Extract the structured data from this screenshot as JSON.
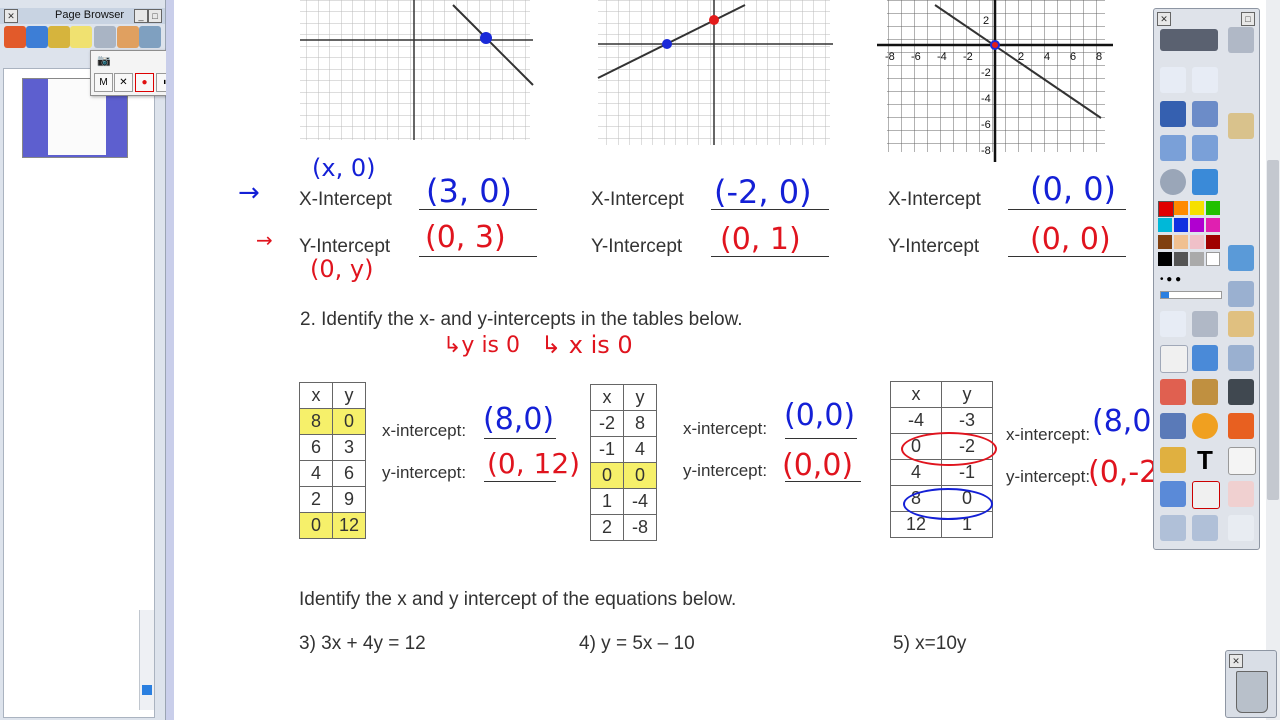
{
  "page_browser": {
    "title": "Page Browser",
    "tools": [
      "page-icon",
      "gallery-icon",
      "attachment-icon",
      "notes-icon",
      "properties-icon",
      "document-icon",
      "addon-icon"
    ]
  },
  "recorder": {
    "buttons": [
      "M",
      "✕",
      "●",
      "⏸",
      "■",
      "▶"
    ]
  },
  "worksheet": {
    "graphs": [
      {
        "xint_label": "X-Intercept",
        "yint_label": "Y-Intercept",
        "x_answer": "(3, 0)",
        "y_answer": "(0, 3)"
      },
      {
        "xint_label": "X-Intercept",
        "yint_label": "Y-Intercept",
        "x_answer": "(-2, 0)",
        "y_answer": "(0, 1)"
      },
      {
        "xint_label": "X-Intercept",
        "yint_label": "Y-Intercept",
        "x_answer": "(0, 0)",
        "y_answer": "(0, 0)"
      }
    ],
    "note_x0": "(x, 0)",
    "note_0y": "(0, y)",
    "graph3_ticks": [
      "-8",
      "-6",
      "-4",
      "-2",
      "2",
      "4",
      "6",
      "8"
    ],
    "graph3_yticks": [
      "2",
      "-2",
      "-4",
      "-6",
      "-8"
    ],
    "q2_text": "2. Identify the x- and y-intercepts in the tables below.",
    "q2_note1": "↳y is 0",
    "q2_note2": "↳ x is 0",
    "tables": [
      {
        "headers": [
          "x",
          "y"
        ],
        "rows": [
          [
            "8",
            "0"
          ],
          [
            "6",
            "3"
          ],
          [
            "4",
            "6"
          ],
          [
            "2",
            "9"
          ],
          [
            "0",
            "12"
          ]
        ],
        "xint_label": "x-intercept:",
        "yint_label": "y-intercept:",
        "x_answer": "(8,0)",
        "y_answer": "(0, 12)"
      },
      {
        "headers": [
          "x",
          "y"
        ],
        "rows": [
          [
            "-2",
            "8"
          ],
          [
            "-1",
            "4"
          ],
          [
            "0",
            "0"
          ],
          [
            "1",
            "-4"
          ],
          [
            "2",
            "-8"
          ]
        ],
        "xint_label": "x-intercept:",
        "yint_label": "y-intercept:",
        "x_answer": "(0,0)",
        "y_answer": "(0,0)"
      },
      {
        "headers": [
          "x",
          "y"
        ],
        "rows": [
          [
            "-4",
            "-3"
          ],
          [
            "0",
            "-2"
          ],
          [
            "4",
            "-1"
          ],
          [
            "8",
            "0"
          ],
          [
            "12",
            "1"
          ]
        ],
        "xint_label": "x-intercept:",
        "yint_label": "y-intercept:",
        "x_answer": "(8,0)",
        "y_answer": "(0,-2)"
      }
    ],
    "q3_heading": "Identify the x and y intercept of the equations below.",
    "equations": [
      "3)  3x + 4y = 12",
      "4)  y = 5x – 10",
      "5)  x=10y"
    ]
  },
  "colors": {
    "blue_ink": "#1420d6",
    "red_ink": "#e0141e",
    "highlight": "#f6f06a"
  }
}
